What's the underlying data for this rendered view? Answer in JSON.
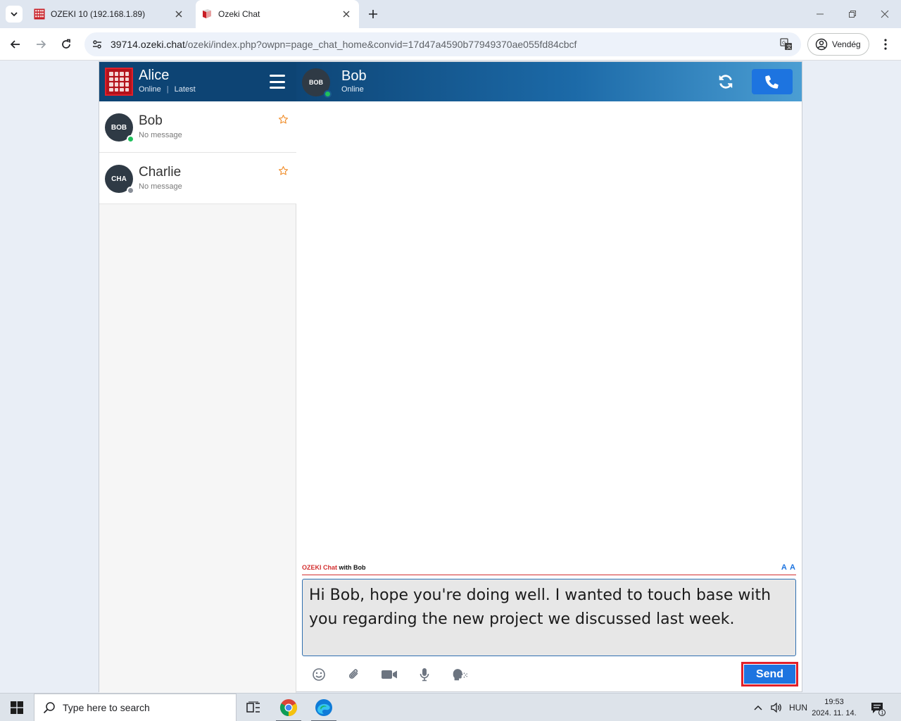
{
  "browser": {
    "tabs": [
      {
        "title": "OZEKI 10 (192.168.1.89)",
        "active": false,
        "favicon": "ozeki-grid-icon"
      },
      {
        "title": "Ozeki Chat",
        "active": true,
        "favicon": "ozeki-chat-icon"
      }
    ],
    "url_host": "39714.ozeki.chat",
    "url_path": "/ozeki/index.php?owpn=page_chat_home&convid=17d47a4590b77949370ae055fd84cbcf",
    "profile_label": "Vendég"
  },
  "sidebar": {
    "user_name": "Alice",
    "user_status": "Online",
    "status_separator": "|",
    "filter_label": "Latest",
    "contacts": [
      {
        "initials": "BOB",
        "name": "Bob",
        "message": "No message",
        "presence": "online"
      },
      {
        "initials": "CHA",
        "name": "Charlie",
        "message": "No message",
        "presence": "offline"
      }
    ]
  },
  "chat": {
    "avatar_initials": "BOB",
    "name": "Bob",
    "status": "Online",
    "composer_brand": "OZEKI Chat",
    "composer_with": "with Bob",
    "font_size_label": "A A",
    "message_draft": "Hi Bob, hope you're doing well. I wanted to touch base with you regarding the new project we discussed last week.",
    "send_label": "Send"
  },
  "taskbar": {
    "search_placeholder": "Type here to search",
    "language": "HUN",
    "time": "19:53",
    "date": "2024. 11. 14.",
    "notification_count": "1"
  },
  "colors": {
    "sidebar_header": "#0d4474",
    "accent_blue": "#1d74e0",
    "highlight_red": "#e0202a",
    "online_green": "#1fc05c",
    "star_orange": "#f08a24"
  }
}
